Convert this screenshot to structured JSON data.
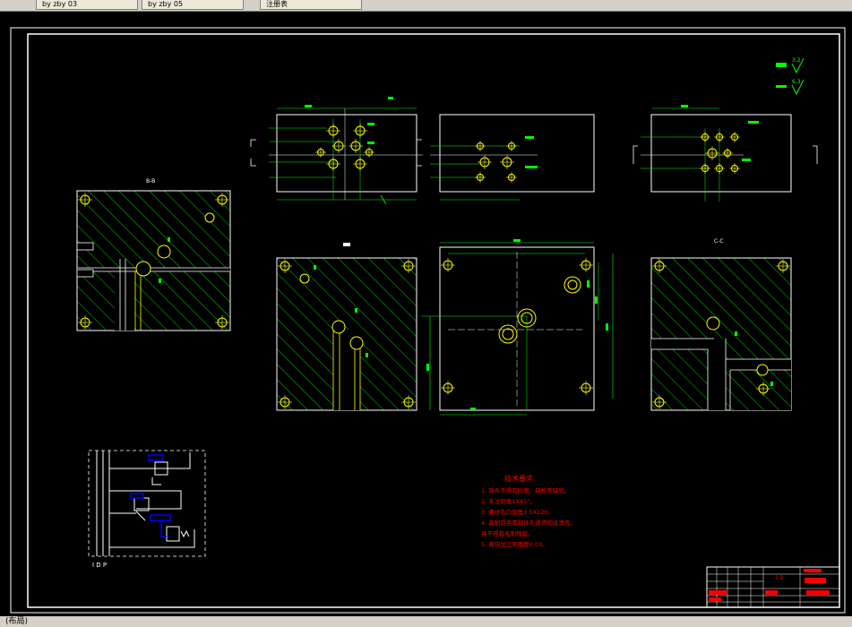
{
  "tabs": [
    {
      "label": "by zby 03"
    },
    {
      "label": "by zby 05"
    },
    {
      "label": "注册表"
    }
  ],
  "drawing": {
    "section_label_bb": "B-B",
    "section_label_c": "C-C",
    "roughness_a": "3.2",
    "roughness_b": "6.3",
    "notes_title": "技术要求",
    "notes": [
      "1. 铸件不得有砂眼、疏松等缺陷。",
      "2. 未注倒角1X45°。",
      "3. 螺纹孔口倒角1.5X120。",
      "4. 装配前各零部件孔道须彻底清洗，",
      "   并不得有毛刺残留。",
      "5. 阀块加工平面度0.03。"
    ],
    "schematic_labels": "I D P",
    "title_block_scale": "1:2"
  },
  "status": {
    "text": "(布局)"
  },
  "colors": {
    "background": "#000000",
    "line": "#ffffff",
    "hatch": "#00ff00",
    "dim": "#00ff00",
    "hole": "#ffff00",
    "notes": "#ff0000",
    "schematic_blue": "#0000ff"
  }
}
